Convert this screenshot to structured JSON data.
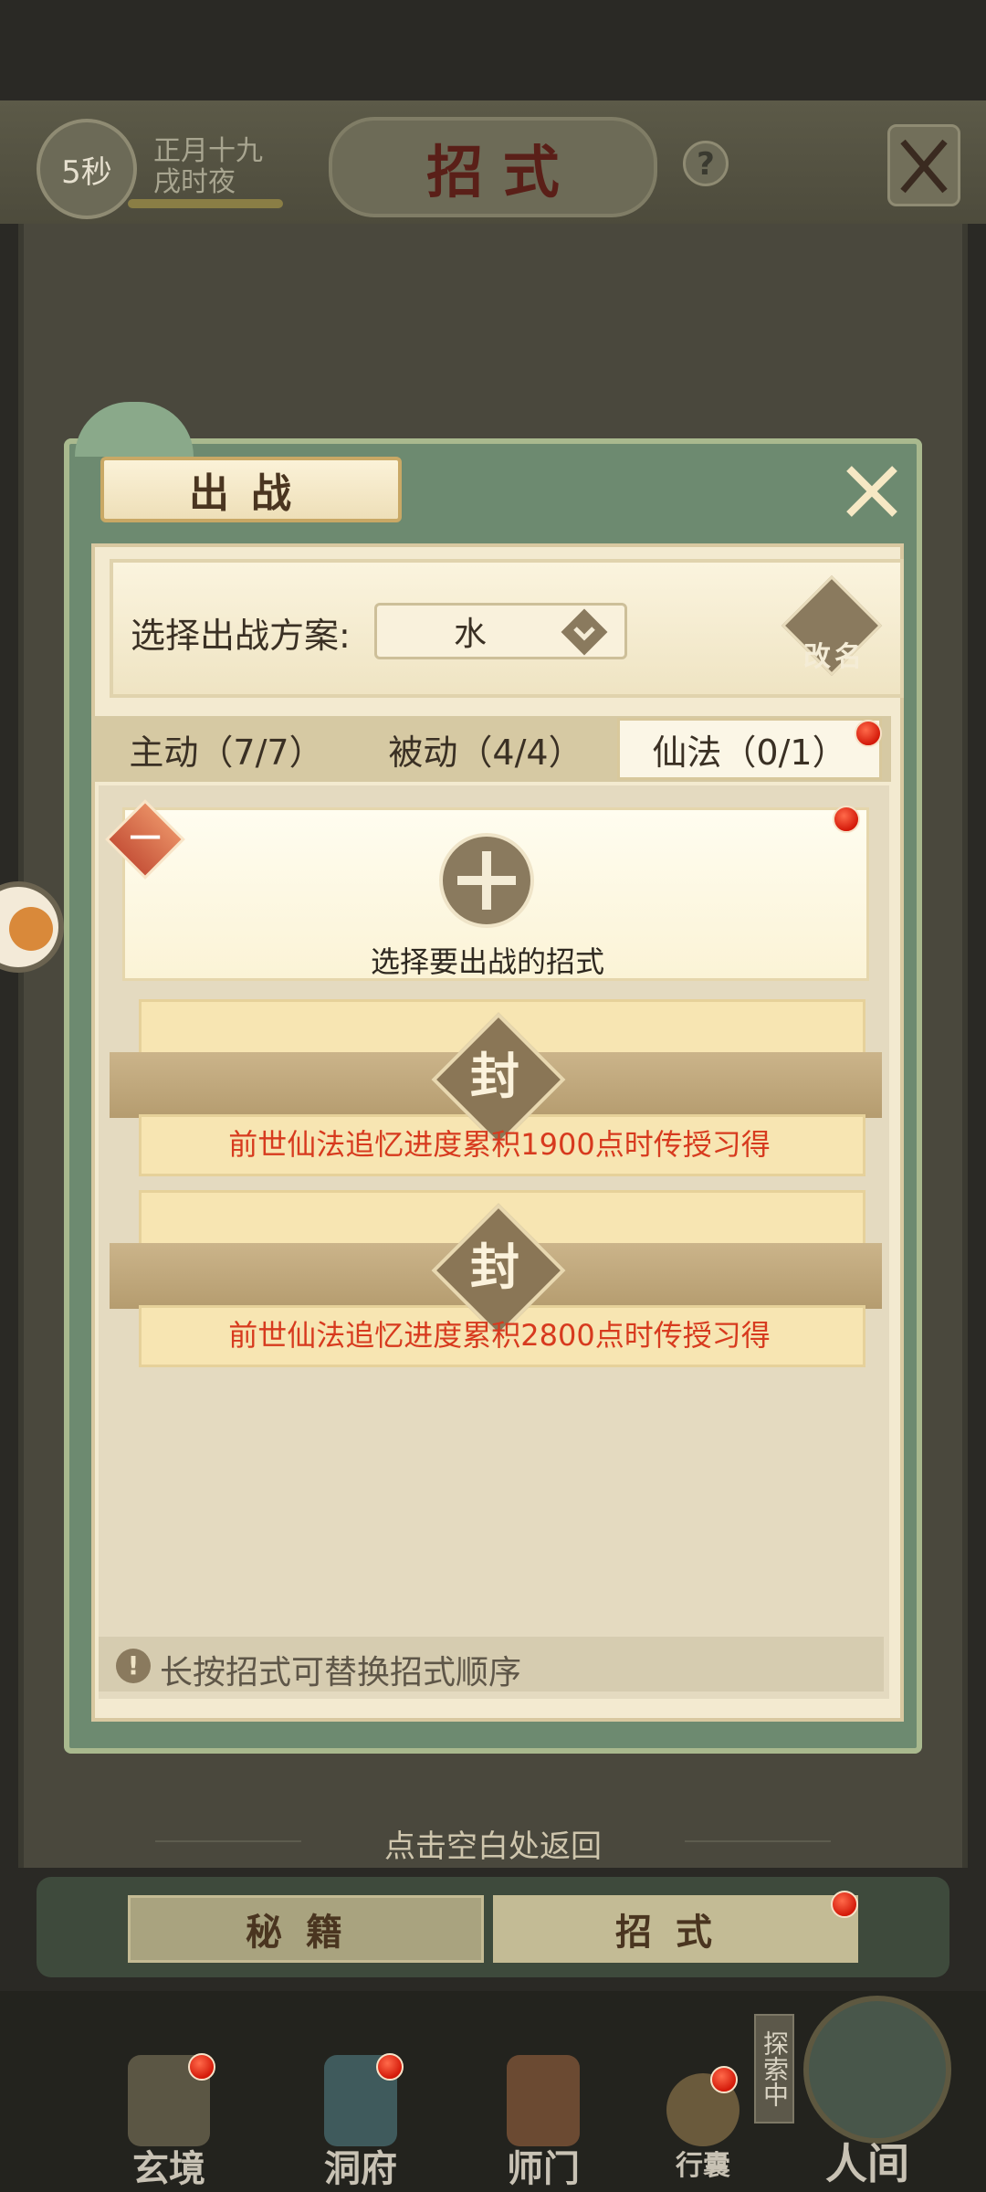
{
  "header": {
    "timer": "5秒",
    "date_line1": "正月十九",
    "date_line2": "戌时夜",
    "title": "招 式",
    "help_icon": "?"
  },
  "modal": {
    "title": "出战",
    "close_icon": "close-x-icon",
    "plan_label": "选择出战方案:",
    "plan_value": "水",
    "rename_label_1": "改",
    "rename_label_2": "名",
    "tabs": [
      {
        "label": "主动（7/7）"
      },
      {
        "label": "被动（4/4）"
      },
      {
        "label": "仙法（0/1）"
      }
    ],
    "slot": {
      "number": "一",
      "prompt": "选择要出战的招式"
    },
    "locked": [
      {
        "seal": "封",
        "text": "前世仙法追忆进度累积1900点时传授习得"
      },
      {
        "seal": "封",
        "text": "前世仙法追忆进度累积2800点时传授习得"
      }
    ],
    "hint_icon": "!",
    "hint": "长按招式可替换招式顺序"
  },
  "return_text": "点击空白处返回",
  "bottom_tabs": [
    {
      "label": "秘籍"
    },
    {
      "label": "招式"
    }
  ],
  "nav": [
    {
      "label": "玄境"
    },
    {
      "label": "洞府"
    },
    {
      "label": "师门"
    },
    {
      "label": "行囊"
    },
    {
      "label": "人间"
    }
  ],
  "explore_badge": "探索中",
  "colors": {
    "accent_red": "#d73a1e",
    "modal_green": "#6d8a70",
    "parchment": "#f3ead0"
  }
}
